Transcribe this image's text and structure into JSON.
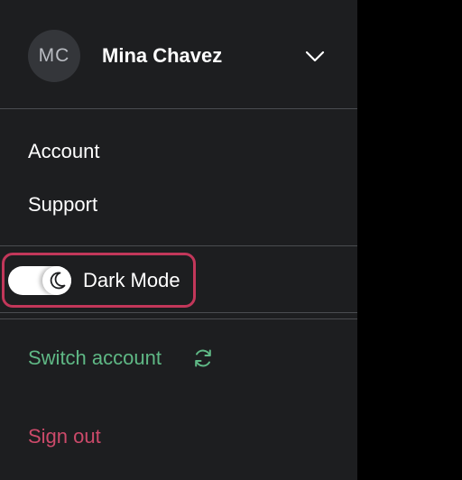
{
  "user": {
    "initials": "MC",
    "name": "Mina Chavez"
  },
  "menu": {
    "items": [
      {
        "label": "Account"
      },
      {
        "label": "Support"
      }
    ]
  },
  "dark_mode": {
    "label": "Dark Mode",
    "enabled": true
  },
  "switch_account": {
    "label": "Switch account"
  },
  "sign_out": {
    "label": "Sign out"
  },
  "icons": {
    "chevron": "chevron-down-icon",
    "moon": "moon-icon",
    "refresh": "refresh-icon"
  },
  "colors": {
    "panel_bg": "#1d1e20",
    "backdrop": "#000000",
    "switch_account": "#5fb885",
    "sign_out": "#cc4a6a",
    "focus_ring": "#c2375a"
  }
}
